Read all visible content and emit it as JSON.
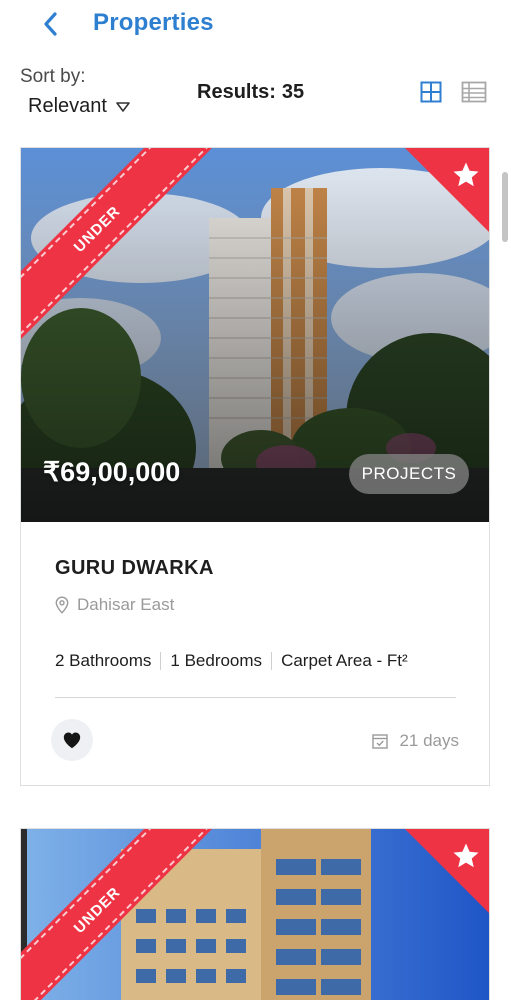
{
  "header": {
    "title": "Properties",
    "back_icon": "chevron-left-icon"
  },
  "toolbar": {
    "sort_label": "Sort by:",
    "sort_value": "Relevant",
    "results_label": "Results:",
    "results_count": "35",
    "view_icons": [
      "grid-view-icon",
      "list-view-icon"
    ]
  },
  "colors": {
    "accent": "#2f7fd1",
    "ribbon": "#ee3344",
    "muted": "#9a9a9a"
  },
  "listings": [
    {
      "status": "UNDER",
      "price": "₹69,00,000",
      "type": "PROJECTS",
      "title": "GURU DWARKA",
      "location": "Dahisar East",
      "bathrooms": "2 Bathrooms",
      "bedrooms": "1 Bedrooms",
      "area": "Carpet Area - Ft²",
      "age": "21 days"
    },
    {
      "status": "UNDER"
    }
  ]
}
